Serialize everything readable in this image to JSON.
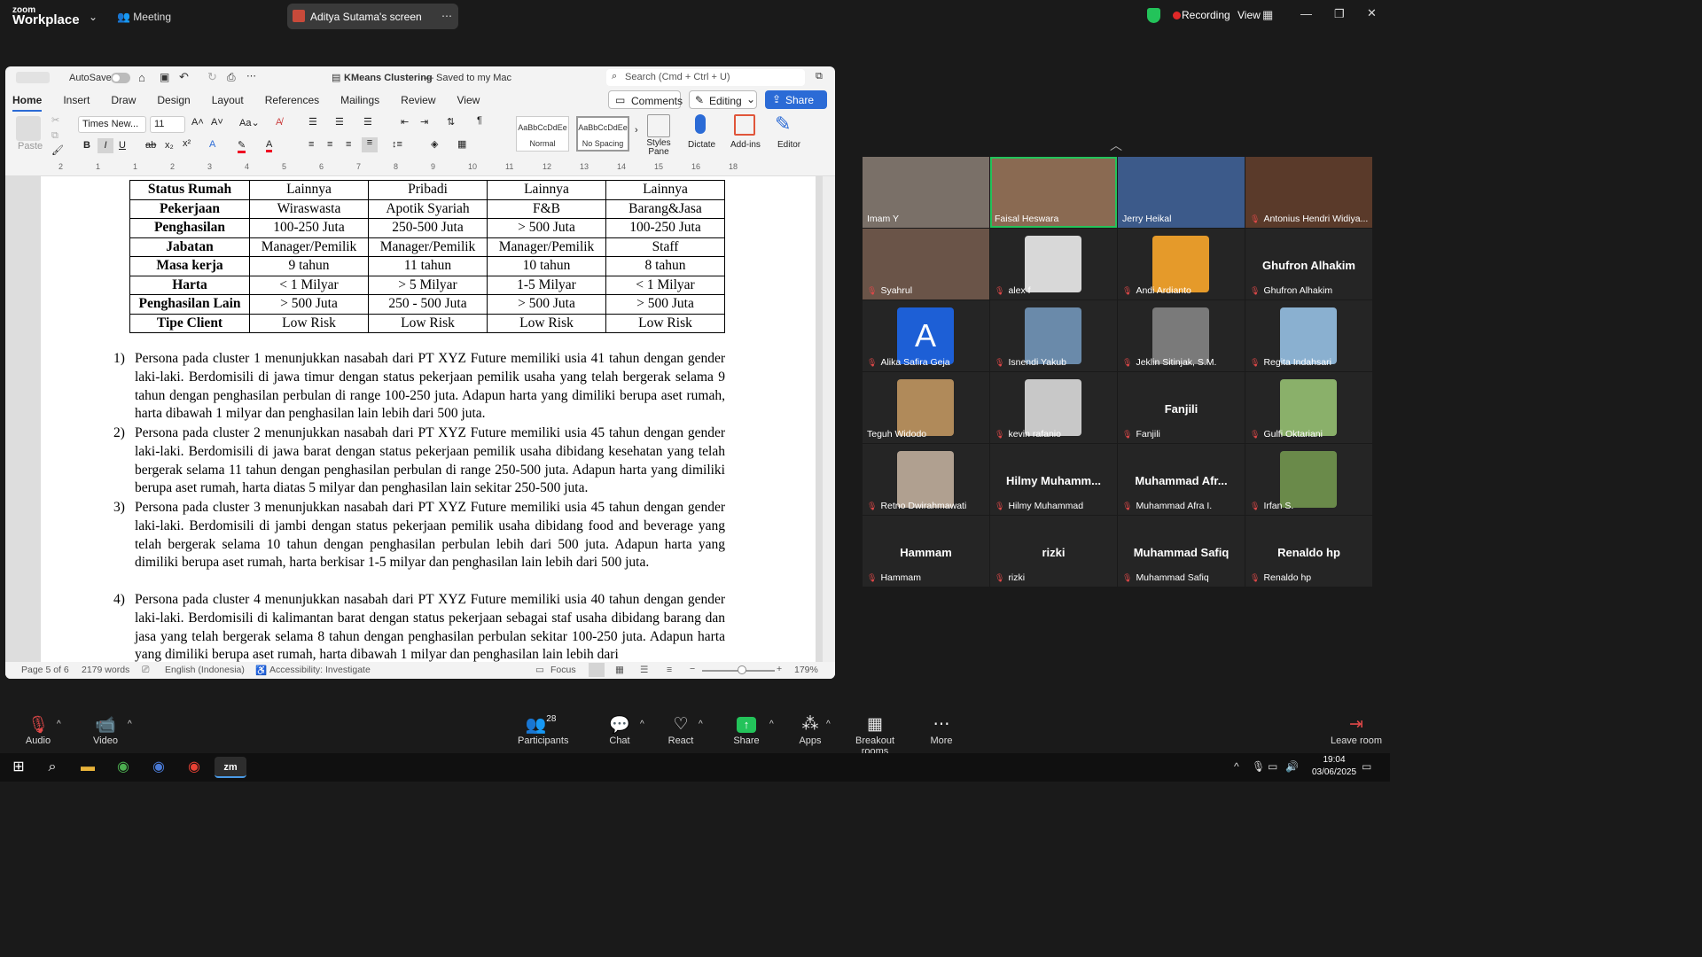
{
  "app": {
    "brand_top": "zoom",
    "brand_bottom": "Workplace",
    "meeting_label": "Meeting",
    "share_label": "Aditya Sutama's screen",
    "recording_label": "Recording",
    "view_label": "View"
  },
  "word": {
    "autosave_label": "AutoSave",
    "doc_title": "KMeans Clustering",
    "saved_status": "— Saved to my Mac",
    "search_placeholder": "Search (Cmd + Ctrl + U)",
    "tabs": [
      "Home",
      "Insert",
      "Draw",
      "Design",
      "Layout",
      "References",
      "Mailings",
      "Review",
      "View"
    ],
    "comments_label": "Comments",
    "editing_label": "Editing",
    "share_label": "Share",
    "font_name": "Times New...",
    "font_size": "11",
    "paste_label": "Paste",
    "style_normal_sample": "AaBbCcDdEe",
    "style_normal_label": "Normal",
    "style_nospacing_sample": "AaBbCcDdEe",
    "style_nospacing_label": "No Spacing",
    "styles_pane_label": "Styles Pane",
    "dictate_label": "Dictate",
    "addins_label": "Add-ins",
    "editor_label": "Editor",
    "ruler_marks": [
      "2",
      "1",
      "1",
      "2",
      "3",
      "4",
      "5",
      "6",
      "7",
      "8",
      "9",
      "10",
      "11",
      "12",
      "13",
      "14",
      "15",
      "16",
      "18"
    ],
    "table": {
      "rows": [
        {
          "h": "Status Rumah",
          "c": [
            "Lainnya",
            "Pribadi",
            "Lainnya",
            "Lainnya"
          ]
        },
        {
          "h": "Pekerjaan",
          "c": [
            "Wiraswasta",
            "Apotik Syariah",
            "F&B",
            "Barang&Jasa"
          ]
        },
        {
          "h": "Penghasilan",
          "c": [
            "100-250 Juta",
            "250-500 Juta",
            "> 500 Juta",
            "100-250 Juta"
          ]
        },
        {
          "h": "Jabatan",
          "c": [
            "Manager/Pemilik",
            "Manager/Pemilik",
            "Manager/Pemilik",
            "Staff"
          ]
        },
        {
          "h": "Masa kerja",
          "c": [
            "9 tahun",
            "11 tahun",
            "10 tahun",
            "8 tahun"
          ]
        },
        {
          "h": "Harta",
          "c": [
            "< 1 Milyar",
            "> 5 Milyar",
            "1-5 Milyar",
            "< 1 Milyar"
          ]
        },
        {
          "h": "Penghasilan Lain",
          "c": [
            "> 500 Juta",
            "250 - 500 Juta",
            "> 500 Juta",
            "> 500 Juta"
          ]
        },
        {
          "h": "Tipe Client",
          "c": [
            "Low Risk",
            "Low Risk",
            "Low Risk",
            "Low Risk"
          ]
        }
      ]
    },
    "paragraphs": [
      {
        "n": "1)",
        "text": "Persona pada cluster 1 menunjukkan nasabah dari PT XYZ Future memiliki usia 41 tahun dengan gender laki-laki. Berdomisili di jawa timur dengan status pekerjaan pemilik usaha yang telah bergerak selama 9 tahun dengan penghasilan perbulan di range 100-250 juta. Adapun harta yang dimiliki berupa aset rumah, harta dibawah 1 milyar dan penghasilan lain lebih dari 500 juta."
      },
      {
        "n": "2)",
        "text": "Persona pada cluster 2 menunjukkan nasabah dari PT XYZ Future memiliki usia 45 tahun dengan gender laki-laki. Berdomisili di jawa barat dengan status pekerjaan pemilik usaha dibidang kesehatan yang telah bergerak selama 11 tahun dengan penghasilan perbulan di range 250-500 juta. Adapun harta yang dimiliki berupa aset rumah, harta diatas 5 milyar dan penghasilan lain sekitar 250-500 juta."
      },
      {
        "n": "3)",
        "text": "Persona pada cluster 3 menunjukkan nasabah dari PT XYZ Future memiliki usia 45 tahun dengan gender laki-laki. Berdomisili di jambi dengan status pekerjaan pemilik usaha dibidang food and beverage yang telah bergerak selama 10 tahun dengan penghasilan perbulan lebih dari 500 juta. Adapun harta yang dimiliki berupa aset rumah, harta berkisar 1-5 milyar dan penghasilan lain lebih dari 500 juta."
      },
      {
        "n": "4)",
        "text": "Persona pada cluster 4 menunjukkan nasabah dari PT XYZ Future memiliki usia 40 tahun dengan gender laki-laki. Berdomisili di kalimantan barat dengan status pekerjaan sebagai staf usaha dibidang barang dan jasa yang telah bergerak selama 8 tahun dengan penghasilan perbulan sekitar 100-250 juta. Adapun harta yang dimiliki berupa aset rumah, harta dibawah 1 milyar dan penghasilan lain lebih dari"
      }
    ],
    "status": {
      "page": "Page 5 of 6",
      "words": "2179 words",
      "language": "English (Indonesia)",
      "accessibility": "Accessibility: Investigate",
      "focus": "Focus",
      "zoom": "179%"
    }
  },
  "participants": [
    {
      "name": "Imam Y",
      "big": "",
      "muted": false,
      "color": "#7a7068"
    },
    {
      "name": "Faisal Heswara",
      "big": "",
      "muted": false,
      "color": "#8a6a52",
      "active": true
    },
    {
      "name": "Jerry Heikal",
      "big": "",
      "muted": false,
      "color": "#3c5a8a"
    },
    {
      "name": "Antonius Hendri Widiya...",
      "big": "",
      "muted": true,
      "color": "#5a3a2a"
    },
    {
      "name": "Syahrul",
      "big": "",
      "muted": true,
      "color": "#6a5448"
    },
    {
      "name": "alex  f",
      "big": "",
      "muted": true,
      "avatar": "#d8d8d8"
    },
    {
      "name": "Andi Ardianto",
      "big": "",
      "muted": true,
      "avatar": "#e59a2a"
    },
    {
      "name": "Ghufron Alhakim",
      "big": "Ghufron Alhakim",
      "muted": true
    },
    {
      "name": "Alika Safira Geja",
      "big": "",
      "muted": true,
      "letter": "A",
      "avatar": "#1d5fd6"
    },
    {
      "name": "Isnendi Yakub",
      "big": "",
      "muted": true,
      "avatar": "#6a8aaa"
    },
    {
      "name": "Jeklin Sitinjak, S.M.",
      "big": "",
      "muted": true,
      "avatar": "#7a7a7a"
    },
    {
      "name": "Regita Indahsari",
      "big": "",
      "muted": true,
      "avatar": "#8ab0d0"
    },
    {
      "name": "Teguh Widodo",
      "big": "",
      "muted": false,
      "avatar": "#b08a5a"
    },
    {
      "name": "kevin rafanio",
      "big": "",
      "muted": true,
      "avatar": "#c8c8c8"
    },
    {
      "name": "Fanjili",
      "big": "Fanjili",
      "muted": true
    },
    {
      "name": "Gulfi Oktariani",
      "big": "",
      "muted": true,
      "avatar": "#8ab06a"
    },
    {
      "name": "Retno Dwirahmawati",
      "big": "",
      "muted": true,
      "avatar": "#b0a090"
    },
    {
      "name": "Hilmy Muhammad",
      "big": "Hilmy  Muhamm...",
      "muted": true
    },
    {
      "name": "Muhammad Afra I.",
      "big": "Muhammad  Afr...",
      "muted": true
    },
    {
      "name": "Irfan S.",
      "big": "",
      "muted": true,
      "avatar": "#6a8a4a"
    },
    {
      "name": "Hammam",
      "big": "Hammam",
      "muted": true
    },
    {
      "name": "rizki",
      "big": "rizki",
      "muted": true
    },
    {
      "name": "Muhammad Safiq",
      "big": "Muhammad Safiq",
      "muted": true
    },
    {
      "name": "Renaldo hp",
      "big": "Renaldo hp",
      "muted": true
    }
  ],
  "toolbar": {
    "audio": "Audio",
    "video": "Video",
    "participants": "Participants",
    "participants_count": "28",
    "chat": "Chat",
    "react": "React",
    "share": "Share",
    "apps": "Apps",
    "breakout": "Breakout rooms",
    "more": "More",
    "leave": "Leave room"
  },
  "taskbar": {
    "time": "19:04",
    "date": "03/06/2025"
  },
  "colors": {
    "accent": "#2b6bd6",
    "share_green": "#23c35a",
    "record_red": "#e02828",
    "mute_red": "#e04848"
  }
}
